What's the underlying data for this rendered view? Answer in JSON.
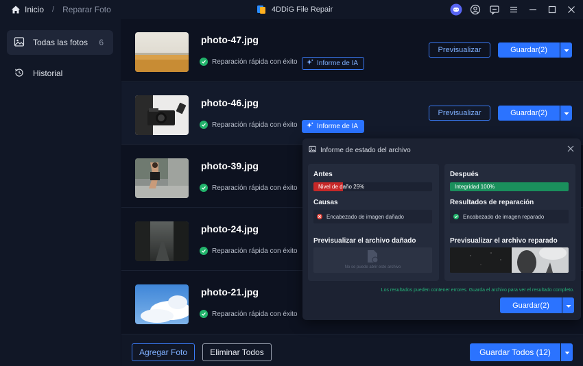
{
  "window": {
    "title": "4DDiG File Repair",
    "breadcrumb": [
      "Inicio",
      "Reparar Foto"
    ]
  },
  "sidebar": {
    "items": [
      {
        "label": "Todas las fotos",
        "count": "6",
        "icon": "image-icon"
      },
      {
        "label": "Historial",
        "icon": "history-icon"
      }
    ]
  },
  "files": [
    {
      "name": "photo-47.jpg",
      "status": "Reparación rápida con éxito",
      "ai_label": "Informe de IA",
      "preview": "Previsualizar",
      "save": "Guardar(2)"
    },
    {
      "name": "photo-46.jpg",
      "status": "Reparación rápida con éxito",
      "ai_label": "Informe de IA",
      "preview": "Previsualizar",
      "save": "Guardar(2)"
    },
    {
      "name": "photo-39.jpg",
      "status": "Reparación rápida con éxito"
    },
    {
      "name": "photo-24.jpg",
      "status": "Reparación rápida con éxito"
    },
    {
      "name": "photo-21.jpg",
      "status": "Reparación rápida con éxito"
    }
  ],
  "footer": {
    "add": "Agregar Foto",
    "delete_all": "Eliminar Todos",
    "save_all": "Guardar Todos (12)"
  },
  "report": {
    "title": "Informe de estado del archivo",
    "before": {
      "heading": "Antes",
      "bar_label": "Nivel de daño 25%",
      "damage_level": 0.25,
      "causes_heading": "Causas",
      "cause": "Encabezado de imagen dañado",
      "preview_heading": "Previsualizar el archivo dañado",
      "preview_msg": "No se puede abrir este archivo"
    },
    "after": {
      "heading": "Después",
      "bar_label": "Integridad 100%",
      "integrity_level": 1.0,
      "results_heading": "Resultados de reparación",
      "result": "Encabezado de imagen reparado",
      "preview_heading": "Previsualizar el archivo reparado"
    },
    "note": "Los resultados pueden contener errores. Guarda el archivo para ver el resultado completo.",
    "save": "Guardar(2)"
  },
  "colors": {
    "accent": "#2b73ff",
    "success": "#22b36b",
    "danger": "#c62828"
  }
}
